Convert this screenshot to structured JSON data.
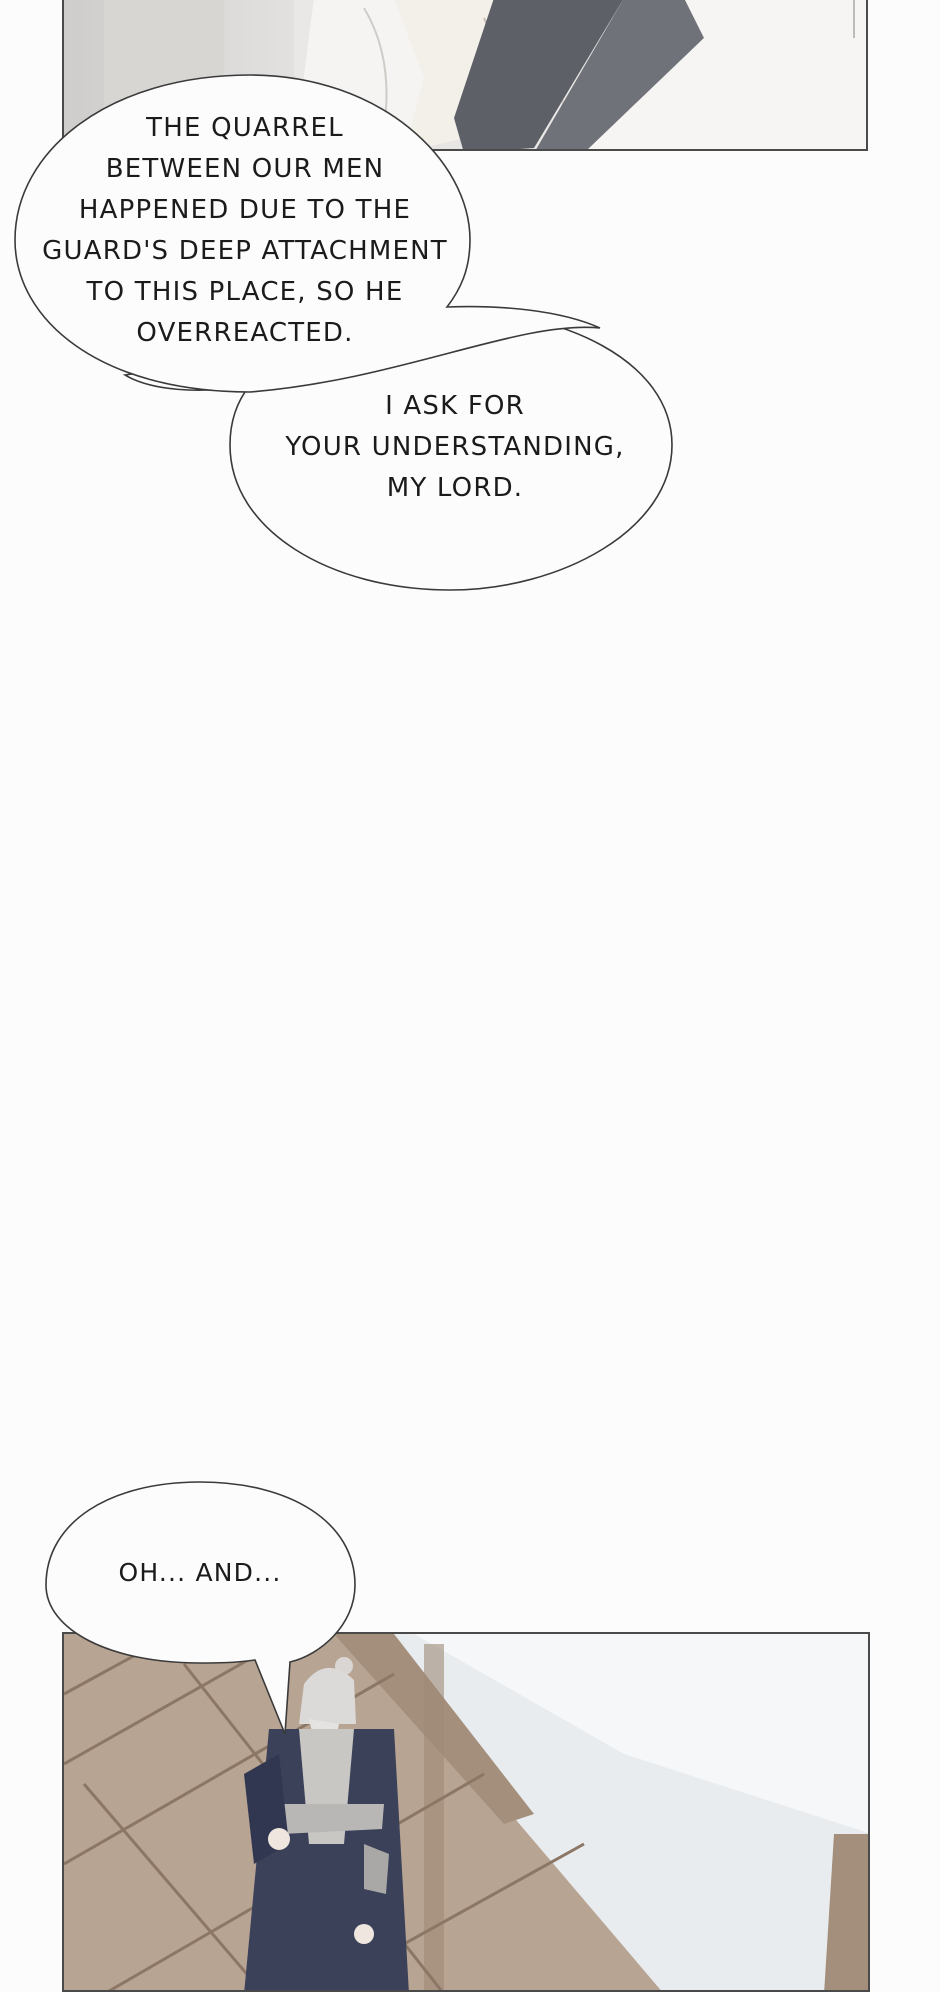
{
  "panels": {
    "top": {
      "description_icon": "robe-figure-panel"
    },
    "bottom": {
      "description_icon": "elder-in-hall-panel"
    }
  },
  "speech": {
    "bubble1": {
      "line1": "THE QUARREL",
      "line2": "BETWEEN OUR MEN",
      "line3": "HAPPENED DUE TO THE",
      "line4": "GUARD'S DEEP ATTACHMENT",
      "line5": "TO THIS PLACE, SO HE",
      "line6": "OVERREACTED."
    },
    "bubble2": {
      "line1": "I ASK FOR",
      "line2": "YOUR UNDERSTANDING,",
      "line3": "MY LORD."
    },
    "bubble3": {
      "line1": "OH... AND..."
    }
  },
  "colors": {
    "background": "#fdfcfc",
    "panel_border": "#4a4a4a",
    "robe_dark": "#3b4159",
    "floor_wood": "#b39f8d"
  }
}
